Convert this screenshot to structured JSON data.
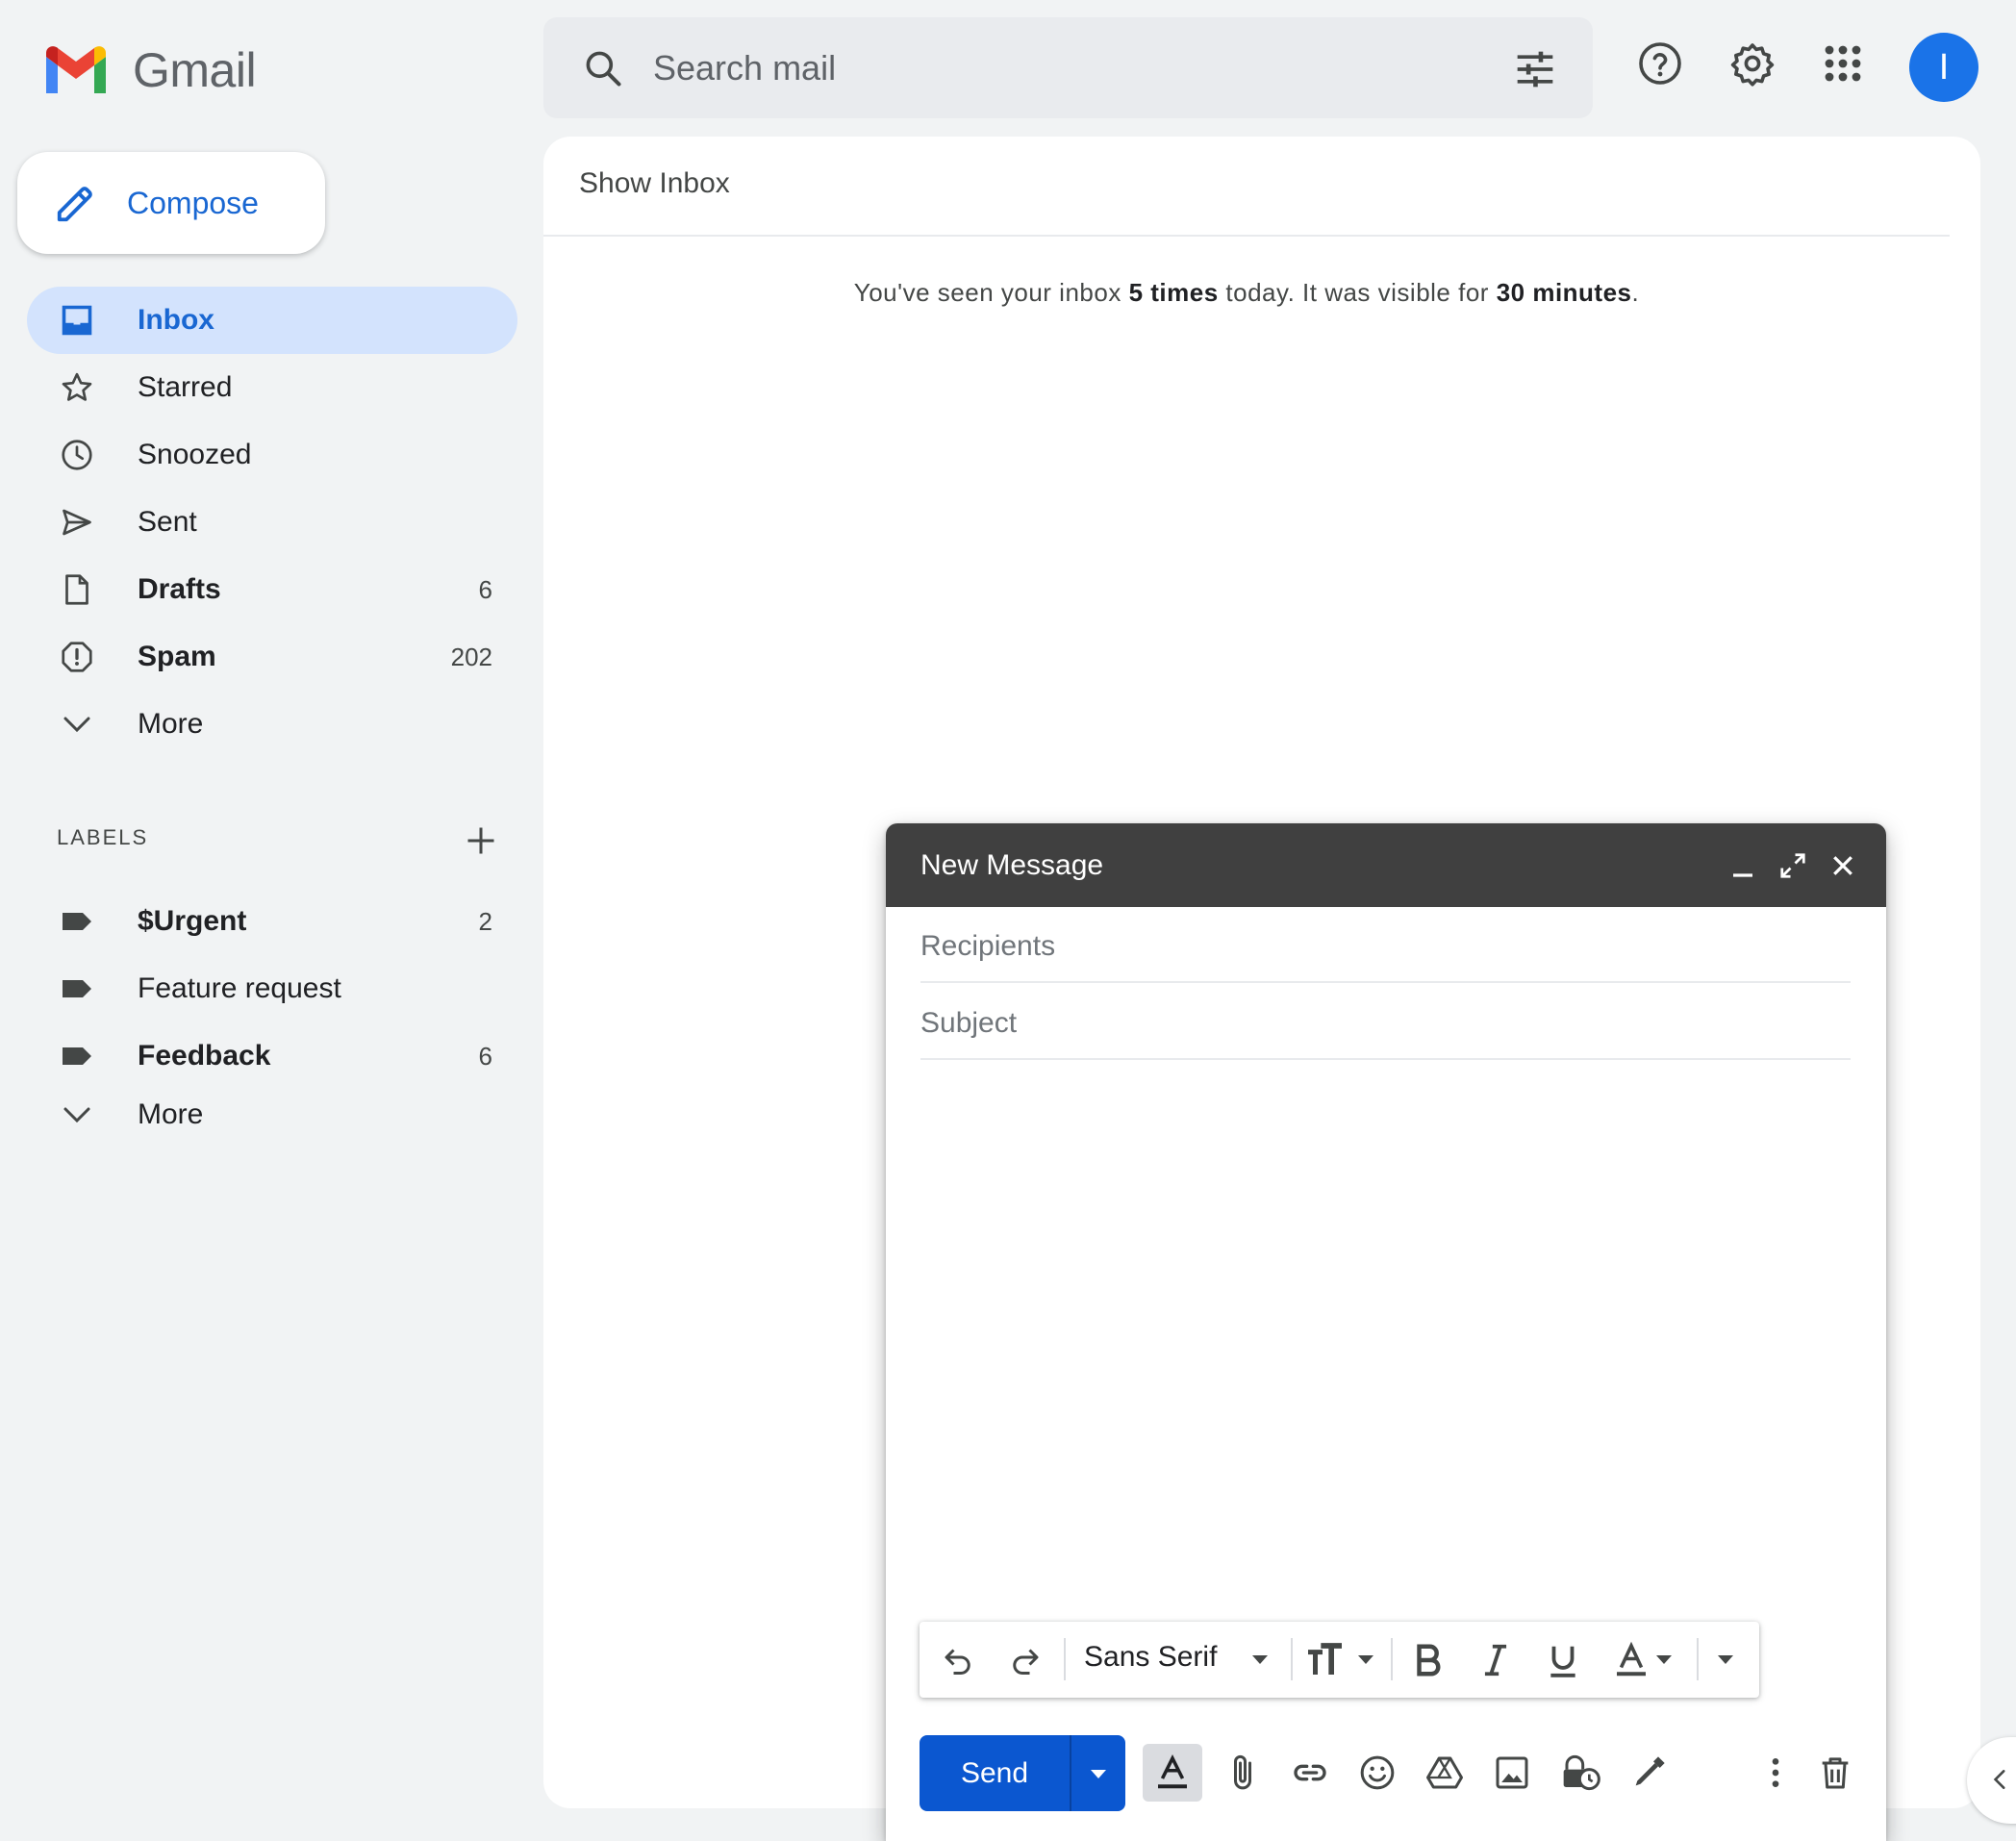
{
  "app": {
    "name": "Gmail",
    "brand_colors": [
      "#4285f4",
      "#ea4335",
      "#fbbc04",
      "#34a853"
    ],
    "accent": "#1a73e8"
  },
  "header": {
    "search_placeholder": "Search mail",
    "avatar_initial": "I",
    "icons": [
      "search-icon",
      "tune-icon",
      "help-icon",
      "settings-icon",
      "apps-icon"
    ]
  },
  "compose_button": {
    "label": "Compose"
  },
  "nav": {
    "items": [
      {
        "label": "Inbox",
        "icon": "inbox-icon",
        "count": "",
        "active": true
      },
      {
        "label": "Starred",
        "icon": "star-icon",
        "count": ""
      },
      {
        "label": "Snoozed",
        "icon": "clock-icon",
        "count": ""
      },
      {
        "label": "Sent",
        "icon": "send-icon",
        "count": ""
      },
      {
        "label": "Drafts",
        "icon": "draft-icon",
        "count": "6",
        "bold": true
      },
      {
        "label": "Spam",
        "icon": "spam-icon",
        "count": "202",
        "bold": true
      },
      {
        "label": "More",
        "icon": "chevron-down-icon",
        "count": ""
      }
    ]
  },
  "labels": {
    "heading": "LABELS",
    "items": [
      {
        "label": "$Urgent",
        "count": "2",
        "bold": true
      },
      {
        "label": "Feature request",
        "count": ""
      },
      {
        "label": "Feedback",
        "count": "6",
        "bold": true
      },
      {
        "label": "More",
        "count": ""
      }
    ]
  },
  "main": {
    "title": "Show Inbox",
    "stats": {
      "prefix": "You've seen your inbox ",
      "times": "5 times",
      "middle": " today. It was visible for ",
      "duration": "30 minutes",
      "suffix": "."
    }
  },
  "compose_window": {
    "title": "New Message",
    "recipients_placeholder": "Recipients",
    "subject_placeholder": "Subject",
    "font_name": "Sans Serif",
    "send_label": "Send"
  }
}
